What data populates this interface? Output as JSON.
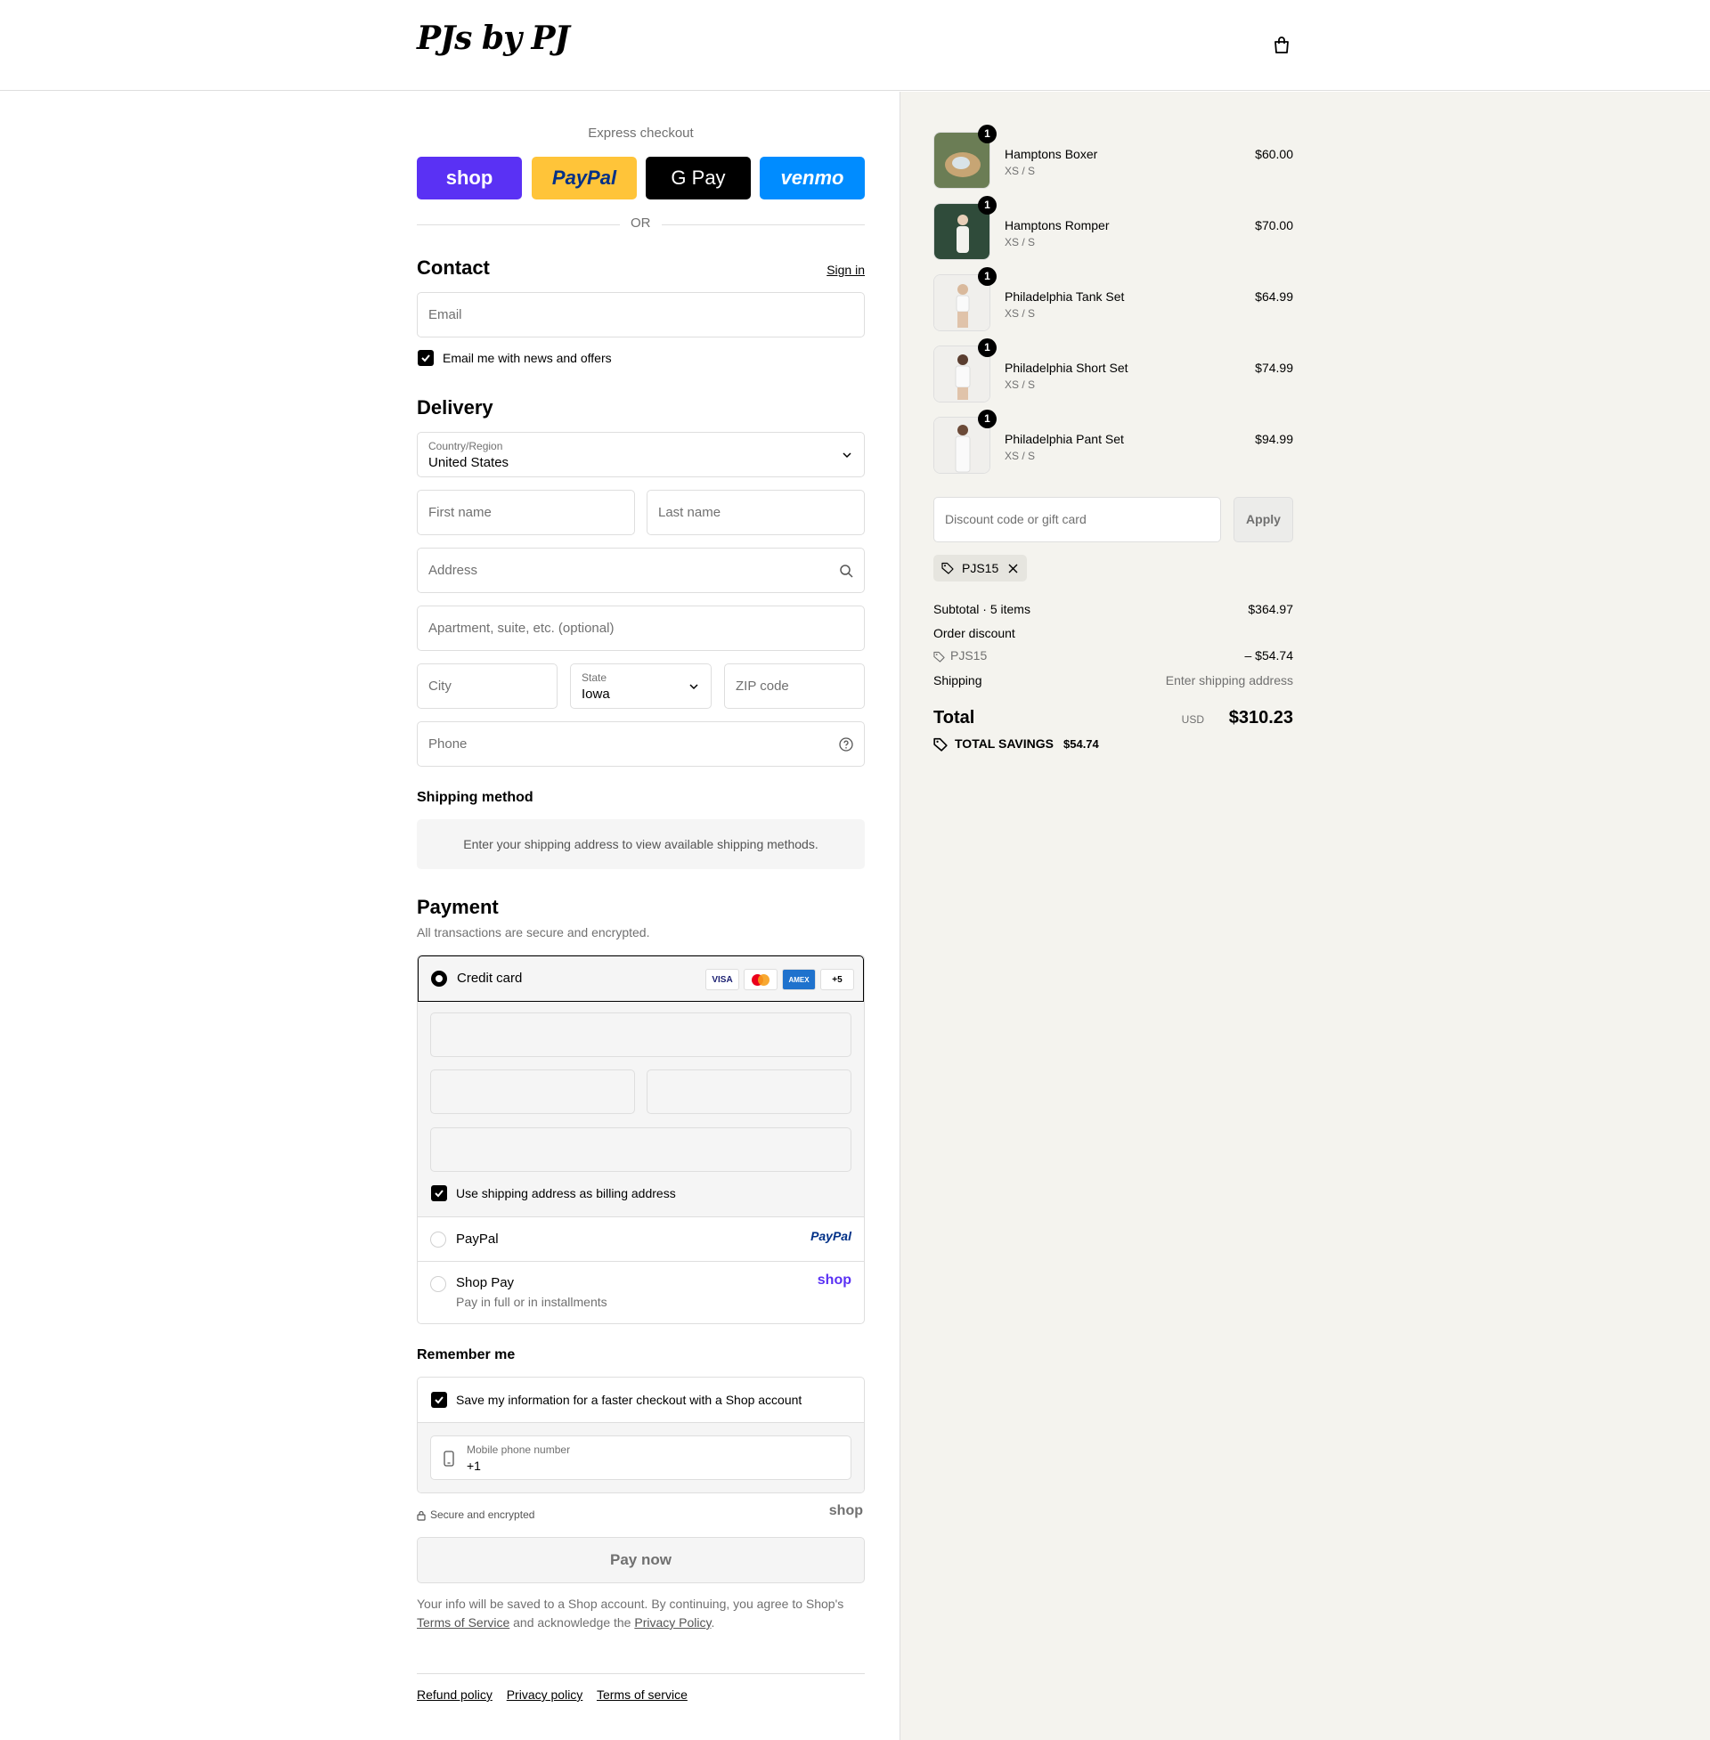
{
  "header": {
    "logo": "PJs by PJ"
  },
  "express": {
    "label": "Express checkout",
    "buttons": [
      "shop",
      "PayPal",
      "G Pay",
      "venmo"
    ],
    "or": "OR"
  },
  "contact": {
    "title": "Contact",
    "sign_in": "Sign in",
    "email_placeholder": "Email",
    "news_label": "Email me with news and offers"
  },
  "delivery": {
    "title": "Delivery",
    "country_label": "Country/Region",
    "country_value": "United States",
    "first_name": "First name",
    "last_name": "Last name",
    "address": "Address",
    "apartment": "Apartment, suite, etc. (optional)",
    "city": "City",
    "state_label": "State",
    "state_value": "Iowa",
    "zip": "ZIP code",
    "phone": "Phone"
  },
  "shipping": {
    "title": "Shipping method",
    "message": "Enter your shipping address to view available shipping methods."
  },
  "payment": {
    "title": "Payment",
    "subtitle": "All transactions are secure and encrypted.",
    "credit_card": "Credit card",
    "cards": [
      "VISA",
      "MC",
      "AMEX",
      "+5"
    ],
    "billing_label": "Use shipping address as billing address",
    "paypal": "PayPal",
    "paypal_logo": "PayPal",
    "shoppay": "Shop Pay",
    "shoppay_sub": "Pay in full or in installments",
    "shoppay_logo": "shop"
  },
  "remember": {
    "title": "Remember me",
    "save_label": "Save my information for a faster checkout with a Shop account",
    "mobile_label": "Mobile phone number",
    "mobile_value": "+1",
    "secure": "Secure and encrypted",
    "shop_logo": "shop"
  },
  "pay_now": "Pay now",
  "legal": {
    "text1": "Your info will be saved to a Shop account. By continuing, you agree to Shop's",
    "tos": "Terms of Service",
    "text2": "and acknowledge the",
    "privacy": "Privacy Policy",
    "end": "."
  },
  "footer": {
    "links": [
      "Refund policy",
      "Privacy policy",
      "Terms of service"
    ]
  },
  "cart": {
    "items": [
      {
        "name": "Hamptons Boxer",
        "variant": "XS / S",
        "price": "$60.00",
        "qty": "1"
      },
      {
        "name": "Hamptons Romper",
        "variant": "XS / S",
        "price": "$70.00",
        "qty": "1"
      },
      {
        "name": "Philadelphia Tank Set",
        "variant": "XS / S",
        "price": "$64.99",
        "qty": "1"
      },
      {
        "name": "Philadelphia Short Set",
        "variant": "XS / S",
        "price": "$74.99",
        "qty": "1"
      },
      {
        "name": "Philadelphia Pant Set",
        "variant": "XS / S",
        "price": "$94.99",
        "qty": "1"
      }
    ],
    "discount_placeholder": "Discount code or gift card",
    "apply": "Apply",
    "applied_code": "PJS15",
    "subtotal_label": "Subtotal · 5 items",
    "subtotal": "$364.97",
    "order_discount": "Order discount",
    "discount_code": "PJS15",
    "discount_amount": "– $54.74",
    "shipping_label": "Shipping",
    "shipping_value": "Enter shipping address",
    "total_label": "Total",
    "currency": "USD",
    "total": "$310.23",
    "savings_label": "TOTAL SAVINGS",
    "savings": "$54.74"
  },
  "colors": {
    "shop": "#5a31f4",
    "paypal": "#ffc439",
    "gpay": "#000000",
    "venmo": "#008cff",
    "sidebar": "#f4f3ee"
  }
}
